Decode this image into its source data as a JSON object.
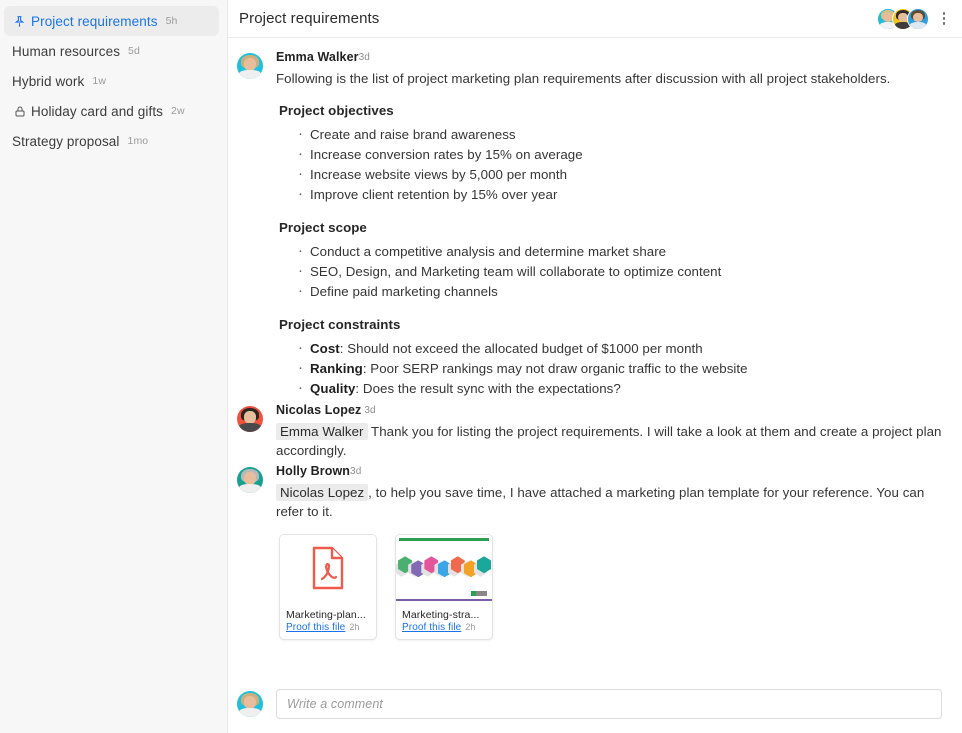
{
  "sidebar": {
    "items": [
      {
        "icon": "pin-icon",
        "label": "Project requirements",
        "time": "5h",
        "selected": true
      },
      {
        "icon": "",
        "label": "Human resources",
        "time": "5d",
        "selected": false
      },
      {
        "icon": "",
        "label": "Hybrid work",
        "time": "1w",
        "selected": false
      },
      {
        "icon": "lock-icon",
        "label": "Holiday card and gifts",
        "time": "2w",
        "selected": false
      },
      {
        "icon": "",
        "label": "Strategy proposal",
        "time": "1mo",
        "selected": false
      }
    ]
  },
  "topbar": {
    "title": "Project requirements",
    "menu_icon": "more-vertical-icon",
    "participants": [
      {
        "name": "Emma Walker",
        "bg": "#20bcd8"
      },
      {
        "name": "Nicolas Lopez",
        "bg": "#f5c518"
      },
      {
        "name": "Holly Brown",
        "bg": "#2b9fe0"
      }
    ]
  },
  "thread": {
    "messages": [
      {
        "author": "Emma Walker",
        "time": "3d",
        "avatar_bg": "#1fc0dd",
        "intro": "Following is the list of project marketing plan requirements after discussion with all project stakeholders.",
        "sections": [
          {
            "title": "Project objectives",
            "items": [
              {
                "label": "",
                "text": "Create and raise brand awareness"
              },
              {
                "label": "",
                "text": "Increase conversion rates by 15% on average"
              },
              {
                "label": "",
                "text": "Increase website views by 5,000 per month"
              },
              {
                "label": "",
                "text": "Improve client retention by 15% over year"
              }
            ]
          },
          {
            "title": "Project scope",
            "items": [
              {
                "label": "",
                "text": "Conduct a competitive analysis and determine market share"
              },
              {
                "label": "",
                "text": "SEO, Design, and Marketing team will collaborate to optimize content"
              },
              {
                "label": "",
                "text": "Define paid marketing channels"
              }
            ]
          },
          {
            "title": "Project constraints",
            "items": [
              {
                "label": "Cost",
                "text": ": Should not exceed the allocated budget of $1000 per month"
              },
              {
                "label": "Ranking",
                "text": ": Poor SERP rankings may not draw organic traffic to the website"
              },
              {
                "label": "Quality",
                "text": ": Does the result sync with the expectations?"
              }
            ]
          }
        ]
      },
      {
        "author": "Nicolas Lopez",
        "time": "3d",
        "avatar_bg": "#f4503c",
        "mention": "Emma Walker",
        "text": " Thank you for listing the project requirements. I will take a look at them and create a project plan accordingly."
      },
      {
        "author": "Holly Brown",
        "time": "3d",
        "avatar_bg": "#17a090",
        "mention": "Nicolas Lopez",
        "text": ", to help you save time, I have attached a marketing plan template for your reference. You can refer to it."
      }
    ],
    "attachments": [
      {
        "kind": "pdf",
        "name": "Marketing-plan...",
        "action": "Proof this file",
        "time": "2h",
        "icon": "pdf-file-icon"
      },
      {
        "kind": "slide",
        "name": "Marketing-stra...",
        "action": "Proof this file",
        "time": "2h",
        "icon": "presentation-thumbnail"
      }
    ]
  },
  "composer": {
    "placeholder": "Write a comment",
    "avatar_bg": "#1fc0dd"
  },
  "colors": {
    "accent": "#1a73e8",
    "sidebar_bg": "#f7f7f7",
    "selected_bg": "#ececec",
    "mention_bg": "#ebebeb",
    "pdf_red": "#ef5a4c"
  }
}
